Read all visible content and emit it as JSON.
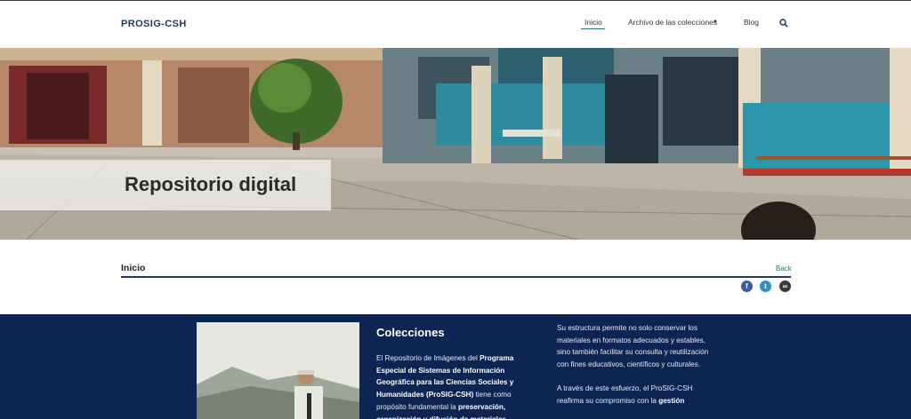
{
  "header": {
    "logo": "PROSIG-CSH",
    "nav": {
      "home": "Inicio",
      "archive": "Archivo de las colecciones",
      "blog": "Blog"
    }
  },
  "hero": {
    "title": "Repositorio digital"
  },
  "breadcrumb": {
    "current": "Inicio",
    "back": "Back"
  },
  "share": {
    "facebook": "f",
    "twitter": "t",
    "link": "∞"
  },
  "collections": {
    "title": "Colecciones",
    "intro_1": "El Repositorio de Imágenes del ",
    "intro_bold_1": "Programa Especial de Sistemas de Información Geográfica para las Ciencias Sociales y Humanidades (ProSIG-CSH)",
    "intro_2": " tiene como propósito fundamental la ",
    "intro_bold_2": "preservación, organización y difusión de materiales",
    "right_p1": "Su estructura permite no solo conservar los materiales en formatos adecuados y estables, sino también facilitar su consulta y reutilización con fines educativos, científicos y culturales.",
    "right_p2_a": "A través de este esfuerzo, el ProSIG-CSH reafirma su compromiso con la ",
    "right_p2_bold": "gestión"
  },
  "colors": {
    "brand": "#1c3a66",
    "accent": "#2c6f7a",
    "section_bg": "#0d2553"
  }
}
